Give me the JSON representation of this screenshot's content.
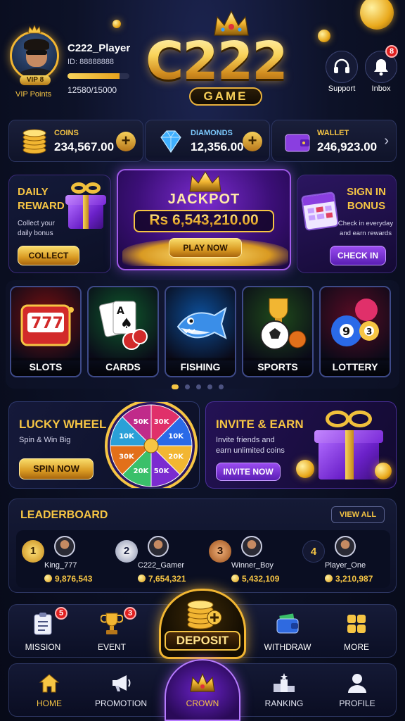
{
  "user": {
    "name": "C222_Player",
    "id": "ID: 88888888",
    "vip_level": "VIP 8",
    "vip_points_label": "VIP Points",
    "xp_text": "12580/15000",
    "xp_progress": 0.84
  },
  "logo": {
    "main": "C222",
    "sub": "GAME"
  },
  "header_buttons": {
    "support_label": "Support",
    "inbox_label": "Inbox",
    "inbox_badge": "8"
  },
  "currencies": {
    "coins": {
      "label": "COINS",
      "value": "234,567.00"
    },
    "diamonds": {
      "label": "DIAMONDS",
      "value": "12,356.00"
    },
    "wallet": {
      "label": "WALLET",
      "value": "246,923.00"
    }
  },
  "promos": {
    "daily": {
      "title_line1": "DAILY",
      "title_line2": "REWARD",
      "desc_line1": "Collect your",
      "desc_line2": "daily bonus",
      "button": "COLLECT"
    },
    "jackpot": {
      "title": "JACKPOT",
      "amount": "Rs 6,543,210.00",
      "button": "PLAY NOW"
    },
    "signin": {
      "title_line1": "SIGN IN",
      "title_line2": "BONUS",
      "desc_line1": "Check in everyday",
      "desc_line2": "and earn rewards",
      "button": "CHECK IN"
    }
  },
  "games": [
    {
      "label": "SLOTS",
      "color": "#7a1010"
    },
    {
      "label": "CARDS",
      "color": "#0f5a2c"
    },
    {
      "label": "FISHING",
      "color": "#0c4f9a"
    },
    {
      "label": "SPORTS",
      "color": "#1f4a1a"
    },
    {
      "label": "LOTTERY",
      "color": "#5a0c24"
    }
  ],
  "carousel": {
    "pages": 5,
    "active": 0
  },
  "lucky_wheel": {
    "title": "LUCKY WHEEL",
    "desc": "Spin & Win Big",
    "button": "SPIN NOW",
    "segments": [
      "30K",
      "10K",
      "20K",
      "50K",
      "20K",
      "30K",
      "10K",
      "50K"
    ]
  },
  "invite": {
    "title": "INVITE & EARN",
    "desc_line1": "Invite friends and",
    "desc_line2": "earn unlimited coins",
    "button": "INVITE NOW"
  },
  "leaderboard": {
    "title": "LEADERBOARD",
    "view_all": "VIEW ALL",
    "entries": [
      {
        "rank": "1",
        "name": "King_777",
        "score": "9,876,543"
      },
      {
        "rank": "2",
        "name": "C222_Gamer",
        "score": "7,654,321"
      },
      {
        "rank": "3",
        "name": "Winner_Boy",
        "score": "5,432,109"
      },
      {
        "rank": "4",
        "name": "Player_One",
        "score": "3,210,987"
      }
    ]
  },
  "actions": {
    "mission": {
      "label": "MISSION",
      "badge": "5"
    },
    "event": {
      "label": "EVENT",
      "badge": "3"
    },
    "deposit": {
      "label": "DEPOSIT"
    },
    "withdraw": {
      "label": "WITHDRAW"
    },
    "more": {
      "label": "MORE"
    }
  },
  "nav": {
    "home": "HOME",
    "promotion": "PROMOTION",
    "crown": "CROWN",
    "ranking": "RANKING",
    "profile": "PROFILE"
  },
  "colors": {
    "gold": "#f6c544",
    "purple": "#7b2bd0",
    "background": "#0d1228"
  }
}
